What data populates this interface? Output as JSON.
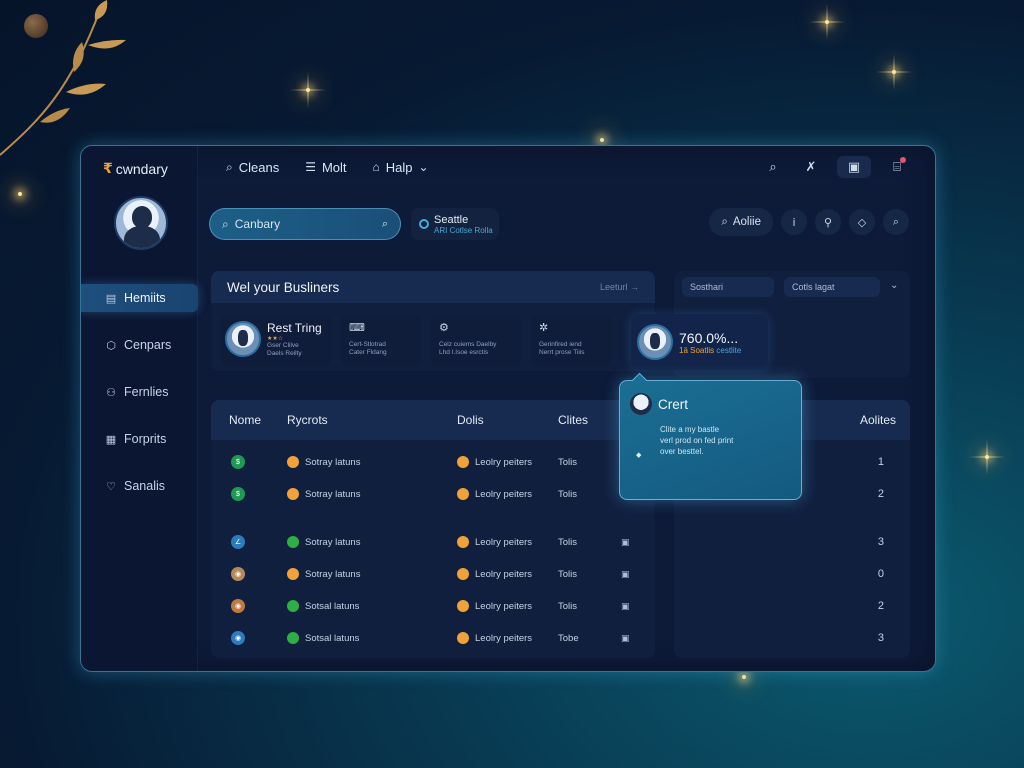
{
  "brand": {
    "mark": "₹",
    "name": "cwndary"
  },
  "topnav": {
    "items": [
      {
        "label": "Cleans",
        "icon": "search-icon"
      },
      {
        "label": "Molt",
        "icon": "menu-icon"
      },
      {
        "label": "Halp",
        "icon": "home-icon"
      }
    ]
  },
  "sidebar": {
    "items": [
      {
        "label": "Hemiits",
        "icon": "document-icon",
        "active": true
      },
      {
        "label": "Cenpars",
        "icon": "cube-icon"
      },
      {
        "label": "Fernlies",
        "icon": "users-icon"
      },
      {
        "label": "Forprits",
        "icon": "grid-icon"
      },
      {
        "label": "Sanalis",
        "icon": "heart-icon"
      }
    ]
  },
  "search": {
    "value": "Canbary"
  },
  "location": {
    "title": "Seattle",
    "subtitle": "Cotlse Rolla",
    "prefix": "ARI"
  },
  "toolbar": {
    "pill_label": "Aoliie"
  },
  "business": {
    "title": "Wel your Busliners",
    "meta": "Leeturl →",
    "cards": [
      {
        "title": "Rest Tring",
        "stars": "★★☆",
        "line1": "Gser Clilve",
        "line2": "Daels Reilty"
      },
      {
        "line1": "Cert-Stlotrad",
        "line2": "Cater Fldang"
      },
      {
        "line1": "Celz cuiems Daelby",
        "line2": "Lhd I.Isoe esrctis"
      },
      {
        "line1": "Gerinfired iend",
        "line2": "Nerrt prose Tiiis"
      }
    ]
  },
  "stat": {
    "value": "760.0%...",
    "sub_a": "1ä Soatlis",
    "sub_b": "cestlite"
  },
  "right_panel": {
    "field1": "Sosthari",
    "field2": "Cotls lagat"
  },
  "table": {
    "headers": [
      "Nome",
      "Rycrots",
      "Dolis",
      "Clites"
    ],
    "right_header": "Aolites",
    "rows": [
      {
        "icon_color": "#1f9a55",
        "status_color": "#f0a23a",
        "a": "Sotray latuns",
        "b": "Leolry peiters",
        "c": "Tolis",
        "num": "1"
      },
      {
        "icon_color": "#1f9a55",
        "status_color": "#f0a23a",
        "a": "Sotray latuns",
        "b": "Leolry peiters",
        "c": "Tolis",
        "num": "2"
      },
      {
        "icon_color": "#2b7bbd",
        "status_color": "#2fae45",
        "a": "Sotray latuns",
        "b": "Leolry peiters",
        "c": "Tolis",
        "num": "3"
      },
      {
        "icon_color": "#b5895a",
        "status_color": "#f0a23a",
        "a": "Sotray latuns",
        "b": "Leolry peiters",
        "c": "Tolis",
        "num": "0"
      },
      {
        "icon_color": "#c07a40",
        "status_color": "#2fae45",
        "a": "Sotsal latuns",
        "b": "Leolry peiters",
        "c": "Tolis",
        "num": "2"
      },
      {
        "icon_color": "#2b7bbd",
        "status_color": "#2fae45",
        "a": "Sotsal latuns",
        "b": "Leolry peiters",
        "c": "Tobe",
        "num": "3"
      }
    ]
  },
  "popup": {
    "title": "Crert",
    "line1": "Clite a my bastle",
    "line2": "verl prod on fed print",
    "line3": "over besttel."
  },
  "colors": {
    "accent": "#4aa8d8",
    "warning": "#f0a23a",
    "success": "#2fae45",
    "window_bg": "#0d1a38"
  }
}
